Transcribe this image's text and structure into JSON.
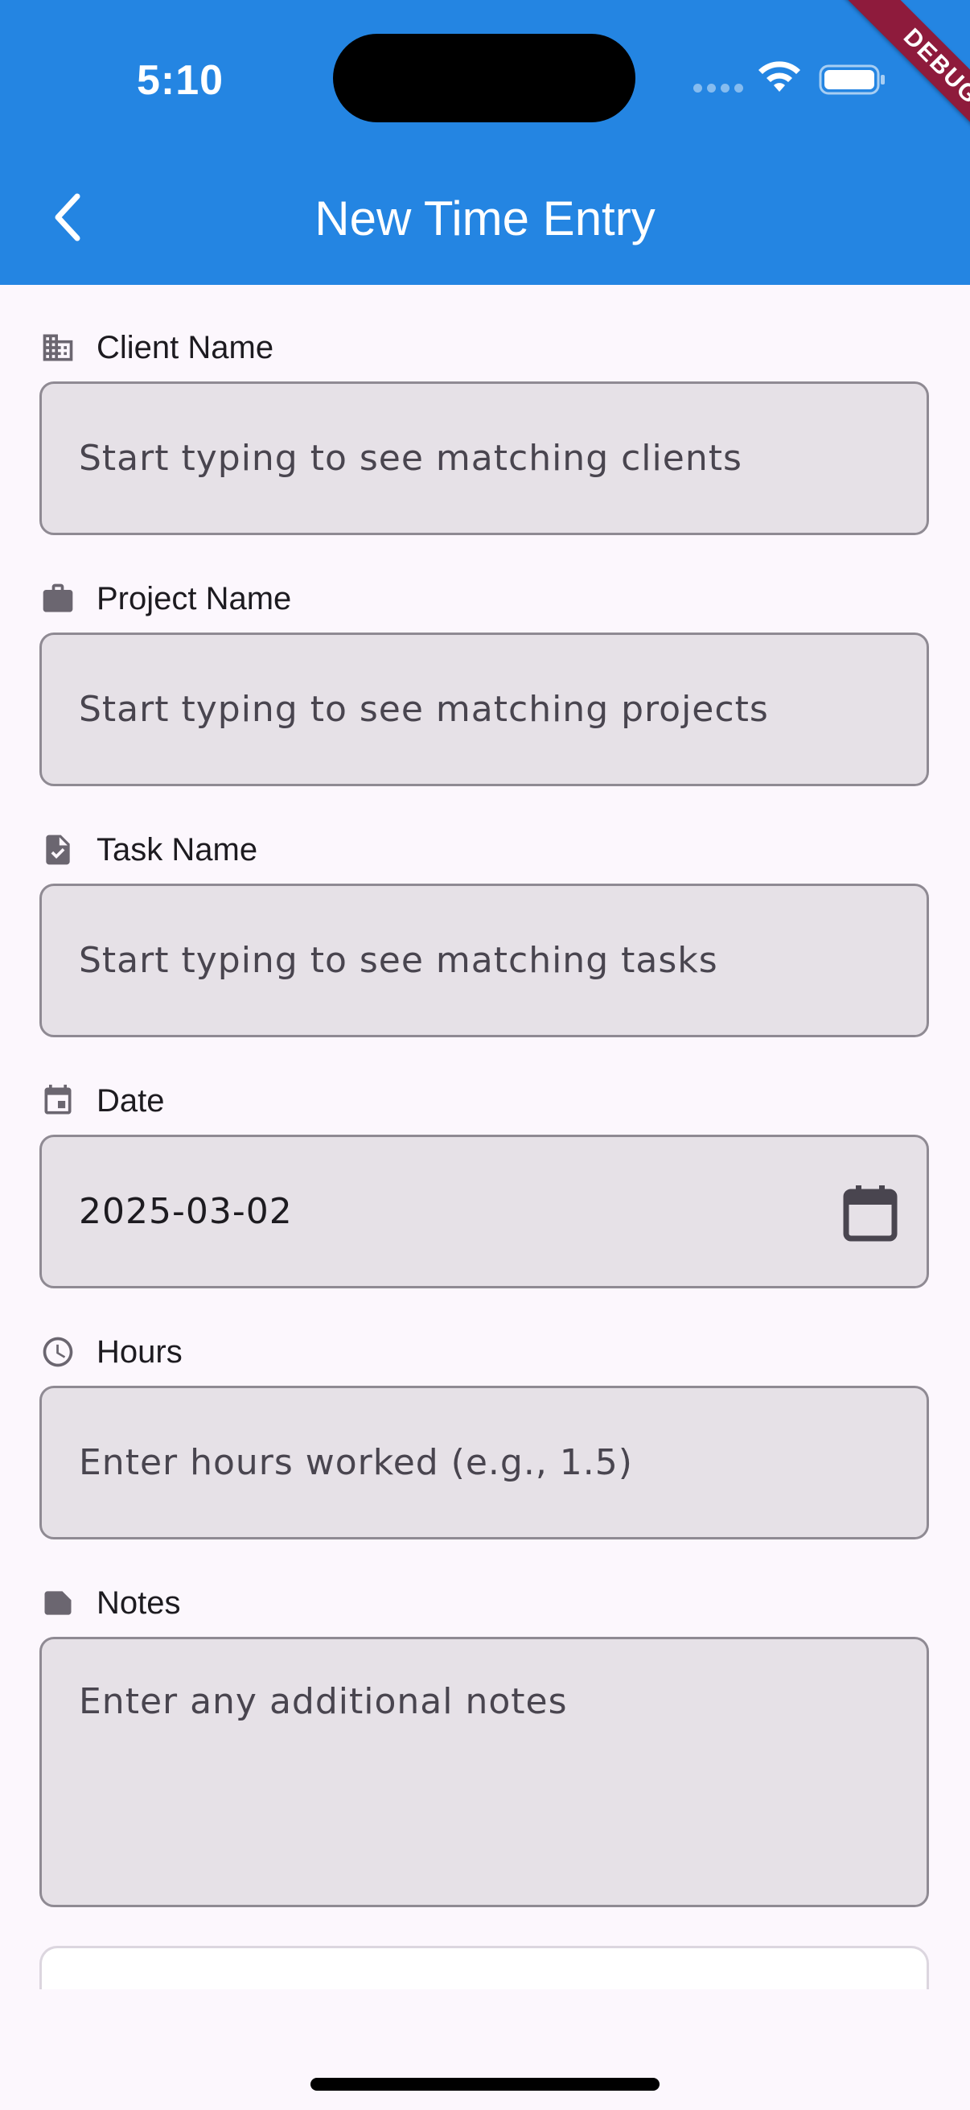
{
  "status_bar": {
    "time": "5:10",
    "debug_banner": "DEBUG"
  },
  "app_bar": {
    "title": "New Time Entry",
    "back_icon": "chevron-left-icon"
  },
  "form": {
    "client": {
      "label": "Client Name",
      "icon": "business-icon",
      "placeholder": "Start typing to see matching clients"
    },
    "project": {
      "label": "Project Name",
      "icon": "briefcase-icon",
      "placeholder": "Start typing to see matching projects"
    },
    "task": {
      "label": "Task Name",
      "icon": "task-icon",
      "placeholder": "Start typing to see matching tasks"
    },
    "date": {
      "label": "Date",
      "icon": "event-icon",
      "value": "2025-03-02",
      "picker_icon": "calendar-icon"
    },
    "hours": {
      "label": "Hours",
      "icon": "clock-icon",
      "placeholder": "Enter hours worked (e.g., 1.5)"
    },
    "notes": {
      "label": "Notes",
      "icon": "label-icon",
      "placeholder": "Enter any additional notes"
    }
  },
  "colors": {
    "app_bar": "#2485e2",
    "background": "#fcf7fd",
    "field_fill": "#e6e1e7",
    "field_border": "#8f8a93",
    "debug": "#8e1b3c"
  }
}
